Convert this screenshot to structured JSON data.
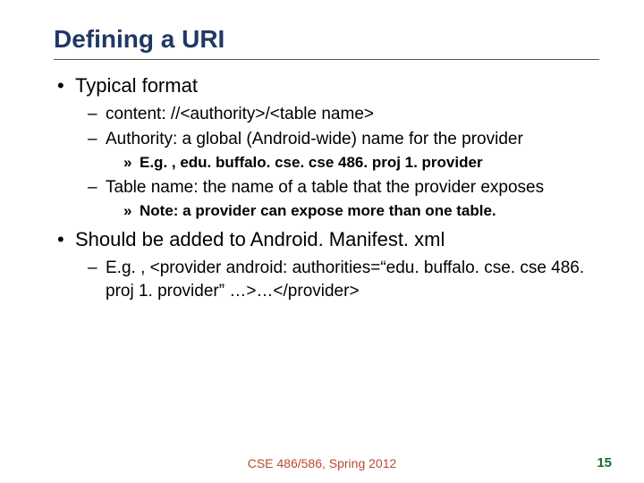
{
  "title": "Defining a URI",
  "bullets": [
    {
      "text": "Typical format",
      "children": [
        {
          "text": "content: //<authority>/<table name>"
        },
        {
          "text": "Authority: a global (Android-wide) name for the provider",
          "children": [
            {
              "text": "E.g. , edu. buffalo. cse. cse 486. proj 1. provider"
            }
          ]
        },
        {
          "text": "Table name: the name of a table that the provider exposes",
          "children": [
            {
              "text": "Note: a provider can expose more than one table."
            }
          ]
        }
      ]
    },
    {
      "text": "Should be added to Android. Manifest. xml",
      "children": [
        {
          "text": "E.g. , <provider android: authorities=“edu. buffalo. cse. cse 486. proj 1. provider” …>…</provider>"
        }
      ]
    }
  ],
  "footer": {
    "center": "CSE 486/586, Spring 2012",
    "page": "15"
  }
}
